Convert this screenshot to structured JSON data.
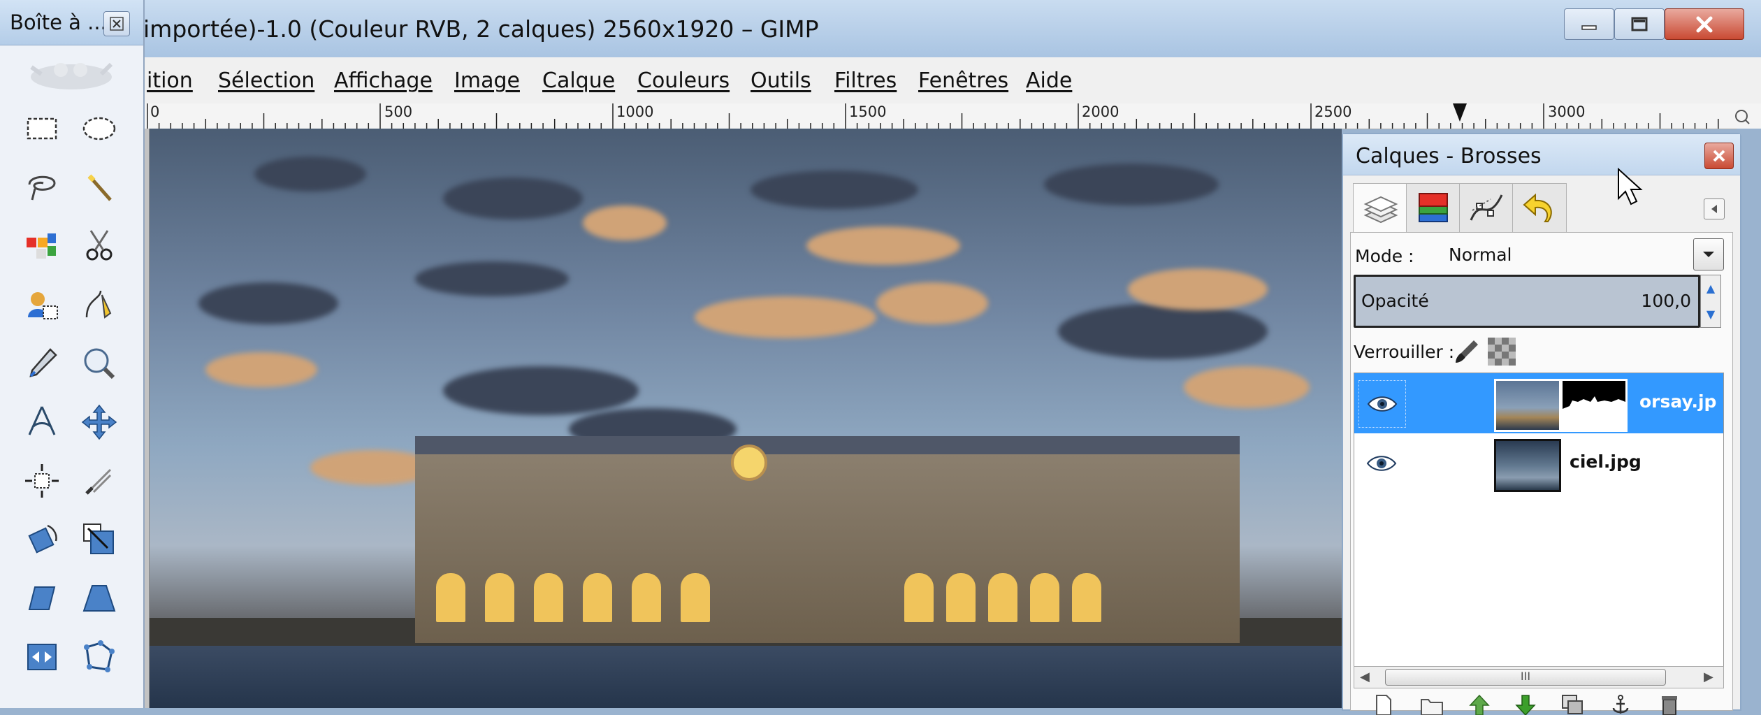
{
  "window": {
    "title": "importée)-1.0 (Couleur RVB, 2 calques) 2560x1920 – GIMP"
  },
  "menubar": {
    "items": [
      "ition",
      "Sélection",
      "Affichage",
      "Image",
      "Calque",
      "Couleurs",
      "Outils",
      "Filtres",
      "Fenêtres",
      "Aide"
    ]
  },
  "ruler": {
    "labels": [
      "0",
      "500",
      "1000",
      "1500",
      "2000",
      "2500",
      "3000"
    ]
  },
  "toolbox": {
    "title": "Boîte à ...",
    "tools": [
      "rect-select-icon",
      "ellipse-select-icon",
      "free-select-icon",
      "fuzzy-select-icon",
      "color-select-icon",
      "scissors-select-icon",
      "foreground-select-icon",
      "paths-tool-icon",
      "color-picker-icon",
      "zoom-icon",
      "measure-icon",
      "move-icon",
      "align-icon",
      "crop-icon",
      "rotate-icon",
      "scale-icon",
      "shear-icon",
      "perspective-icon",
      "flip-icon",
      "cage-transform-icon"
    ]
  },
  "layers_dock": {
    "title": "Calques - Brosses",
    "tabs": [
      "layers-tab-icon",
      "channels-tab-icon",
      "paths-tab-icon",
      "undo-history-tab-icon"
    ],
    "mode_label": "Mode :",
    "mode_value": "Normal",
    "opacity_label": "Opacité",
    "opacity_value": "100,0",
    "opacity_fraction": 1.0,
    "lock_label": "Verrouiller :",
    "layers": [
      {
        "name": "orsay.jp",
        "selected": true,
        "visible": true,
        "has_mask": true
      },
      {
        "name": "ciel.jpg",
        "selected": false,
        "visible": true,
        "has_mask": false
      }
    ],
    "scroll_thumb_label": "III",
    "actions": [
      "new-layer-icon",
      "new-layer-group-icon",
      "raise-layer-icon",
      "lower-layer-icon",
      "duplicate-layer-icon",
      "anchor-layer-icon",
      "delete-layer-icon"
    ]
  },
  "colors": {
    "selection": "#3399ff",
    "titlebar": "#b4cde8",
    "close_red": "#c94a33"
  }
}
